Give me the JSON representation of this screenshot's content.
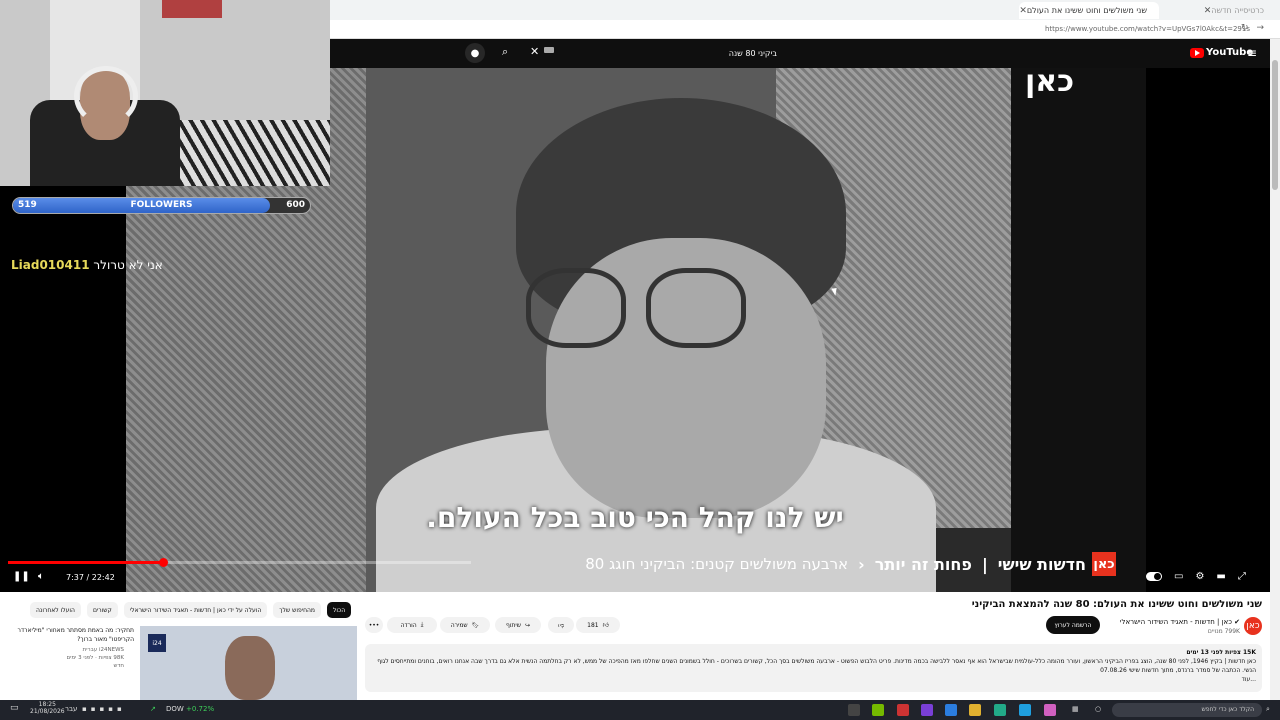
{
  "browser": {
    "tabs": [
      {
        "label": "שני משולשים וחוט ששינו את העולם",
        "active": true
      },
      {
        "label": "כרטיסייה חדשה",
        "active": false
      }
    ],
    "new_tab_icon": "plus-icon",
    "url": "https://www.youtube.com/watch?v=UpVGs7l0Akc&t=291s"
  },
  "youtube": {
    "search_query": "ביקיני 80 שנה",
    "logo_text": "YouTube"
  },
  "video": {
    "watermark": "כאן",
    "subtitle": "יש לנו קהל הכי טוב בכל העולם.",
    "ticker": {
      "logo": "כאן",
      "program": "חדשות שישי",
      "segment": "פחות זה יותר",
      "headline": "ארבעה משולשים קטנים: הביקיני חוגג 80"
    },
    "time_current": "7:37",
    "time_total": "22:42",
    "time_display": "7:37 / 22:42",
    "progress_fraction": 0.335
  },
  "overlay": {
    "followers_current": "519",
    "followers_goal": "600",
    "followers_label": "FOLLOWERS",
    "followers_fraction": 0.865,
    "chat_user": "Liad010411",
    "chat_message": "אני לא טרולר"
  },
  "below": {
    "title": "שני משולשים וחוט ששינו את העולם: 80 שנה להמצאת הביקיני",
    "channel_name": "כאן | חדשות - תאגיד השידור הישראלי",
    "channel_subs": "799K מנויים",
    "channel_avatar": "כאן",
    "subscribe": "הרשמה לערוץ",
    "likes": "181",
    "share": "שיתוף",
    "save": "שמירה",
    "download": "הורדה",
    "more": "•••",
    "description_views": "15K צפיות  לפני 13 ימים",
    "description_text": "כאן חדשות | בקיץ 1946, לפני 80 שנה, הוצג בפריז הביקיני הראשון, ועורר מהומה כלל-עולמית שבישראל הוא אף נאסר ללבישה בכמה מדינות. פריט הלבוש הפשוט - ארבעה משולשים בסך הכל, קשורים בשרוכים - חולל בשמונים השנים שחלפו מאז מהפיכה של ממש, לא רק בחלתמה הנשית אלא גם בדרך שבה אנחנו רואים, בוחנים ומתייחסים לגוף הנשי. הכתבה של סמדר ברנדס, מתוך חדשות שישי 07.08.26",
    "description_more": "...עוד",
    "chips": [
      "הכול",
      "מהחיפוש שלך",
      "הועלה על ידי כאן | חדשות - תאגיד השידור הישראלי",
      "קשורים",
      "הועלו לאחרונה"
    ],
    "rec_title": "תחקיר: מה באמת מסתתר מאחורי \"מיליארדר הקריפטו\" מאור ברוך?",
    "rec_channel": "i24NEWS עברית",
    "rec_meta": "98K צפיות · לפני 3 ימים",
    "rec_badge": "חדש",
    "thumb_logo": "i24"
  },
  "taskbar": {
    "time": "18:25",
    "date": "21/08/2026",
    "lang": "עבר",
    "ticker_name": "DOW",
    "ticker_change": "+0.72%",
    "search_placeholder": "הקלד כאן כדי לחפש"
  },
  "colors": {
    "youtube_red": "#ff0000",
    "kan_orange": "#e8321e",
    "followers_blue": "#3f74d8",
    "chat_user": "#e6d95a",
    "dow_green": "#3ecf5a"
  }
}
